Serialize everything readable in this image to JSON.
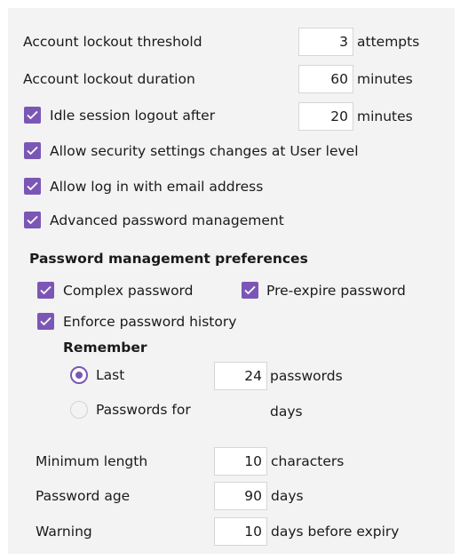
{
  "lockout_threshold": {
    "label": "Account lockout threshold",
    "value": "3",
    "unit": "attempts"
  },
  "lockout_duration": {
    "label": "Account lockout duration",
    "value": "60",
    "unit": "minutes"
  },
  "idle_logout": {
    "label": "Idle session logout after",
    "checked": true,
    "value": "20",
    "unit": "minutes"
  },
  "allow_security_changes": {
    "label": "Allow security settings changes at User level",
    "checked": true
  },
  "allow_email_login": {
    "label": "Allow log in with email address",
    "checked": true
  },
  "advanced_password_mgmt": {
    "label": "Advanced password management",
    "checked": true
  },
  "prefs": {
    "heading": "Password management preferences",
    "complex_password": {
      "label": "Complex password",
      "checked": true
    },
    "pre_expire_password": {
      "label": "Pre-expire password",
      "checked": true
    },
    "enforce_history": {
      "label": "Enforce password history",
      "checked": true
    },
    "remember": {
      "heading": "Remember",
      "last": {
        "label": "Last",
        "selected": true,
        "value": "24",
        "unit": "passwords"
      },
      "passwords_for": {
        "label": "Passwords for",
        "selected": false,
        "value": "",
        "unit": "days"
      }
    },
    "min_length": {
      "label": "Minimum length",
      "value": "10",
      "unit": "characters"
    },
    "password_age": {
      "label": "Password age",
      "value": "90",
      "unit": "days"
    },
    "warning": {
      "label": "Warning",
      "value": "10",
      "unit": "days before expiry"
    }
  },
  "colors": {
    "accent": "#7b57b5",
    "panel_bg": "#f3f3f3"
  }
}
